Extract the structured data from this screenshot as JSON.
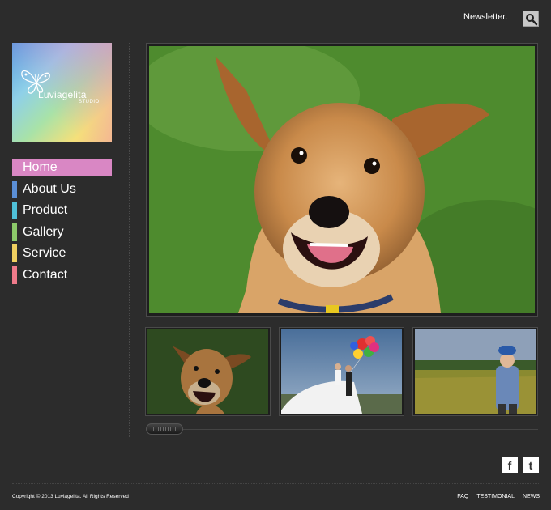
{
  "header": {
    "newsletter_label": "Newsletter.",
    "search_icon": "search-icon"
  },
  "logo": {
    "name": "Luviagelita",
    "sub": "STUDIO"
  },
  "nav": {
    "items": [
      {
        "label": "Home",
        "color": "#d987c4",
        "active": true
      },
      {
        "label": "About Us",
        "color": "#5b8fd6"
      },
      {
        "label": "Product",
        "color": "#4fc0d8"
      },
      {
        "label": "Gallery",
        "color": "#8cc96a"
      },
      {
        "label": "Service",
        "color": "#f0d060"
      },
      {
        "label": "Contact",
        "color": "#ef7a8a"
      }
    ]
  },
  "gallery": {
    "main_image": "dog-photo",
    "thumbnails": [
      "dog-photo",
      "couple-balloons-photo",
      "child-field-photo"
    ],
    "scroll_position": 0
  },
  "social": {
    "facebook_letter": "f",
    "twitter_letter": "t"
  },
  "footer": {
    "copyright": "Copyright © 2013 Luviagelita. All Rights Reserved",
    "links": [
      "FAQ",
      "TESTIMONIAL",
      "NEWS"
    ]
  },
  "colors": {
    "background": "#2c2c2c",
    "active_nav": "#d987c4"
  }
}
